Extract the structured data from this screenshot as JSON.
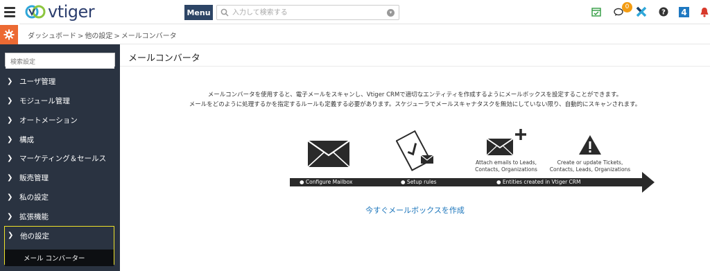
{
  "header": {
    "logo_text": "vtiger",
    "menu_label": "Menu",
    "search_placeholder": "入力して検索する",
    "notification_count": "0",
    "icons": [
      "calendar-check-icon",
      "chat-icon",
      "x-app-icon",
      "help-icon",
      "four-app-icon",
      "bell-icon"
    ]
  },
  "breadcrumb": {
    "items": [
      "ダッシュボード",
      "他の設定",
      "メールコンバータ"
    ],
    "separator": ">"
  },
  "sidebar": {
    "search_placeholder": "検索設定",
    "items": [
      {
        "label": "ユーザ管理"
      },
      {
        "label": "モジュール管理"
      },
      {
        "label": "オートメーション"
      },
      {
        "label": "構成"
      },
      {
        "label": "マーケティング＆セールス"
      },
      {
        "label": "販売管理"
      },
      {
        "label": "私の設定"
      },
      {
        "label": "拡張機能"
      }
    ],
    "open_item": {
      "label": "他の設定"
    },
    "sub_item": {
      "label": "メール コンバーター"
    }
  },
  "main": {
    "title": "メールコンバータ",
    "description_line1": "メールコンバータを使用すると、電子メールをスキャンし、Vtiger CRMで適切なエンティティを作成するようにメールボックスを設定することができます。",
    "description_line2": "メールをどのように処理するかを指定するルールも定義する必要があります。スケジューラでメールスキャナタスクを無効にしていない限り、自動的にスキャンされます。",
    "steps": [
      {
        "label": "● Configure Mailbox"
      },
      {
        "label": "● Setup rules"
      },
      {
        "label": "● Entities created in Vtiger CRM"
      }
    ],
    "captions": {
      "attach_line1": "Attach emails to Leads,",
      "attach_line2": "Contacts, Organizations",
      "create_line1": "Create or update Tickets,",
      "create_line2": "Contacts, Leads, Organizations"
    },
    "create_link": "今すぐメールボックスを作成"
  },
  "colors": {
    "sidebar_bg": "#2a3341",
    "accent_orange": "#ec6a33",
    "highlight_border": "#f0e32a",
    "link_blue": "#1b75bb",
    "menu_btn": "#2d4566"
  }
}
